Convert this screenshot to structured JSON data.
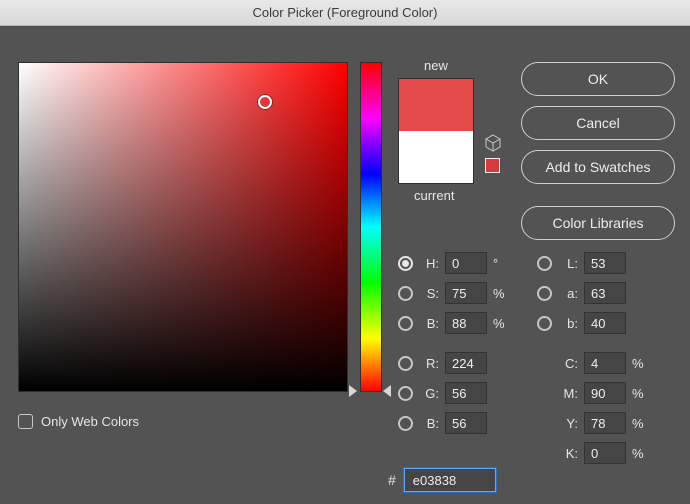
{
  "title": "Color Picker (Foreground Color)",
  "swatch": {
    "new_label": "new",
    "current_label": "current",
    "new_hex": "#e34a4a",
    "current_hex": "#ffffff",
    "out_of_range_hex": "#d73a3a"
  },
  "picker": {
    "hue_deg": 0,
    "sat_pct": 75,
    "bri_pct": 88
  },
  "buttons": {
    "ok": "OK",
    "cancel": "Cancel",
    "add_swatches": "Add to Swatches",
    "libraries": "Color Libraries"
  },
  "hsb": {
    "h_label": "H:",
    "s_label": "S:",
    "b_label": "B:",
    "h": "0",
    "s": "75",
    "b": "88"
  },
  "lab": {
    "l_label": "L:",
    "a_label": "a:",
    "b_label": "b:",
    "l": "53",
    "a": "63",
    "b": "40"
  },
  "rgb": {
    "r_label": "R:",
    "g_label": "G:",
    "b_label": "B:",
    "r": "224",
    "g": "56",
    "b": "56"
  },
  "cmyk": {
    "c_label": "C:",
    "m_label": "M:",
    "y_label": "Y:",
    "k_label": "K:",
    "c": "4",
    "m": "90",
    "y": "78",
    "k": "0"
  },
  "units": {
    "deg": "°",
    "pct": "%"
  },
  "hex": {
    "hash": "#",
    "value": "e03838"
  },
  "web_only_label": "Only Web Colors"
}
